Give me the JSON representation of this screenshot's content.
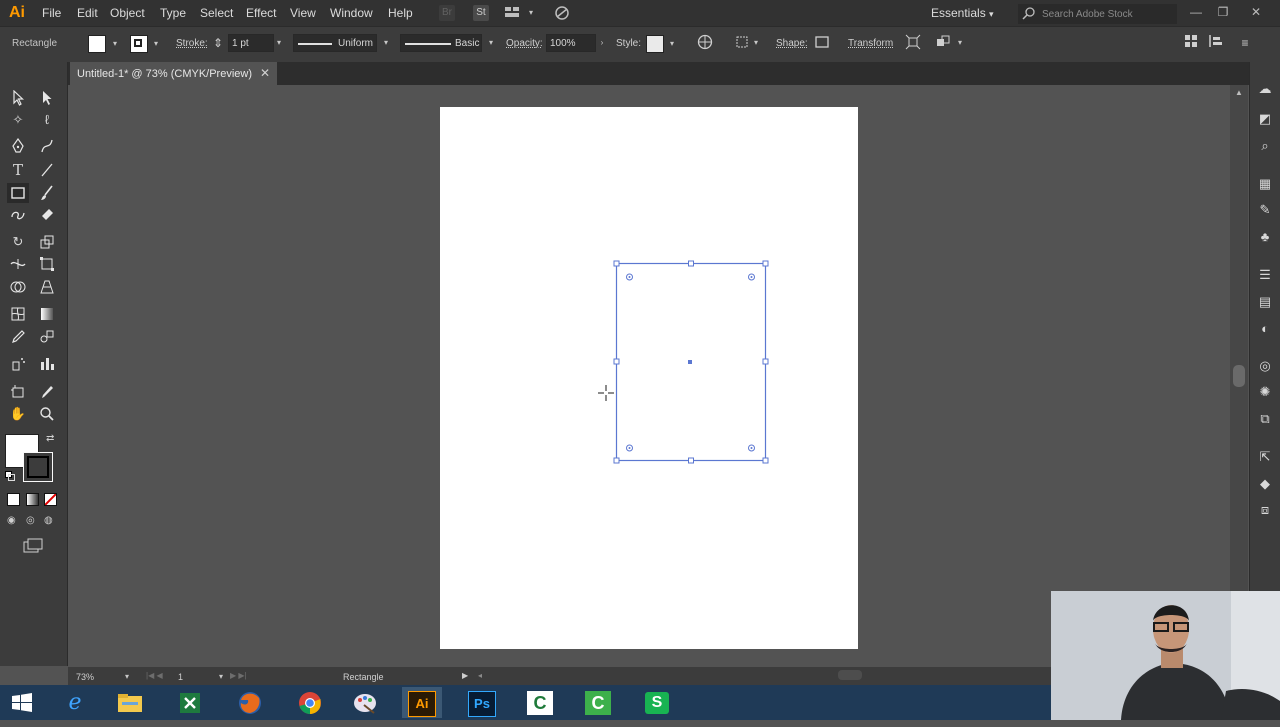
{
  "app": {
    "logo": "Ai"
  },
  "menu": {
    "items": [
      "File",
      "Edit",
      "Object",
      "Type",
      "Select",
      "Effect",
      "View",
      "Window",
      "Help"
    ]
  },
  "menubar_icons": {
    "bridge": "Br",
    "stock": "St"
  },
  "workspace": {
    "label": "Essentials"
  },
  "stock_search": {
    "placeholder": "Search Adobe Stock"
  },
  "control": {
    "tool_name": "Rectangle",
    "stroke_label": "Stroke:",
    "stroke_weight": "1 pt",
    "stroke_profile": "Uniform",
    "brush": "Basic",
    "opacity_label": "Opacity:",
    "opacity_value": "100%",
    "style_label": "Style:",
    "shape_label": "Shape:",
    "transform_label": "Transform"
  },
  "document": {
    "tab_title": "Untitled-1* @ 73% (CMYK/Preview)"
  },
  "statusbar": {
    "zoom": "73%",
    "artboard_number": "1",
    "current_tool": "Rectangle"
  },
  "taskbar": {
    "apps": [
      "Start",
      "Internet Explorer",
      "File Explorer",
      "Excel",
      "Firefox",
      "Chrome",
      "Paint",
      "Illustrator",
      "Photoshop",
      "Camtasia",
      "Camtasia Recorder",
      "Sheets"
    ]
  },
  "colors": {
    "accent": "#ff9a00",
    "selection": "#5b77d1",
    "menubar": "#323232",
    "panel": "#3c3c3c",
    "canvas": "#535353"
  }
}
